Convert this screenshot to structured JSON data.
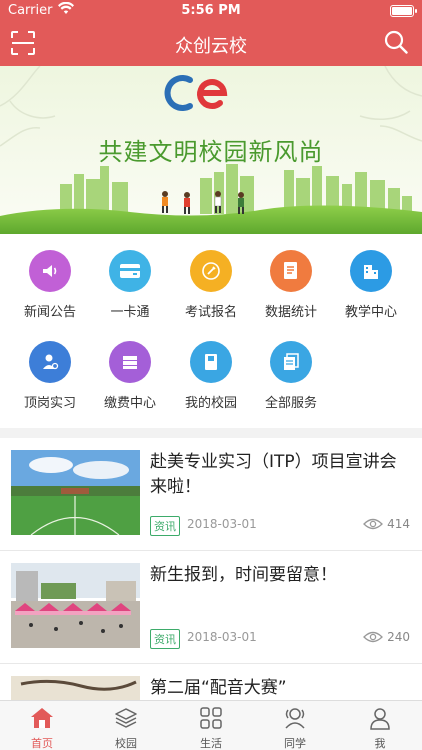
{
  "status_bar": {
    "carrier": "Carrier",
    "time": "5:56 PM"
  },
  "header": {
    "title": "众创云校",
    "left_icon": "scan-icon",
    "right_icon": "search-icon"
  },
  "banner": {
    "slogan": "共建文明校园新风尚",
    "logo": "CE logo"
  },
  "grid": [
    {
      "label": "新闻公告",
      "icon": "speaker-icon",
      "color": "#c160d6"
    },
    {
      "label": "一卡通",
      "icon": "card-icon",
      "color": "#3fb3e6"
    },
    {
      "label": "考试报名",
      "icon": "pen-icon",
      "color": "#f5b023"
    },
    {
      "label": "数据统计",
      "icon": "document-icon",
      "color": "#f07b3f"
    },
    {
      "label": "教学中心",
      "icon": "building-icon",
      "color": "#2c9be4"
    },
    {
      "label": "顶岗实习",
      "icon": "person-icon",
      "color": "#3d7ed8"
    },
    {
      "label": "缴费中心",
      "icon": "money-stack-icon",
      "color": "#a45fd8"
    },
    {
      "label": "我的校园",
      "icon": "book-icon",
      "color": "#3aa6e3"
    },
    {
      "label": "全部服务",
      "icon": "files-icon",
      "color": "#3aa6e3"
    }
  ],
  "news": [
    {
      "title": "赴美专业实习（ITP）项目宣讲会来啦！",
      "tag": "资讯",
      "date": "2018-03-01",
      "views": "414"
    },
    {
      "title": "新生报到，时间要留意！",
      "tag": "资讯",
      "date": "2018-03-01",
      "views": "240"
    },
    {
      "title": "第二届“配音大赛”",
      "tag": "",
      "date": "",
      "views": ""
    }
  ],
  "tabs": [
    {
      "label": "首页",
      "icon": "home-icon",
      "active": true
    },
    {
      "label": "校园",
      "icon": "layers-icon",
      "active": false
    },
    {
      "label": "生活",
      "icon": "grid-icon",
      "active": false
    },
    {
      "label": "同学",
      "icon": "classmates-icon",
      "active": false
    },
    {
      "label": "我",
      "icon": "profile-icon",
      "active": false
    }
  ],
  "colors": {
    "brand": "#e25a59",
    "tag": "#3dab6a"
  }
}
